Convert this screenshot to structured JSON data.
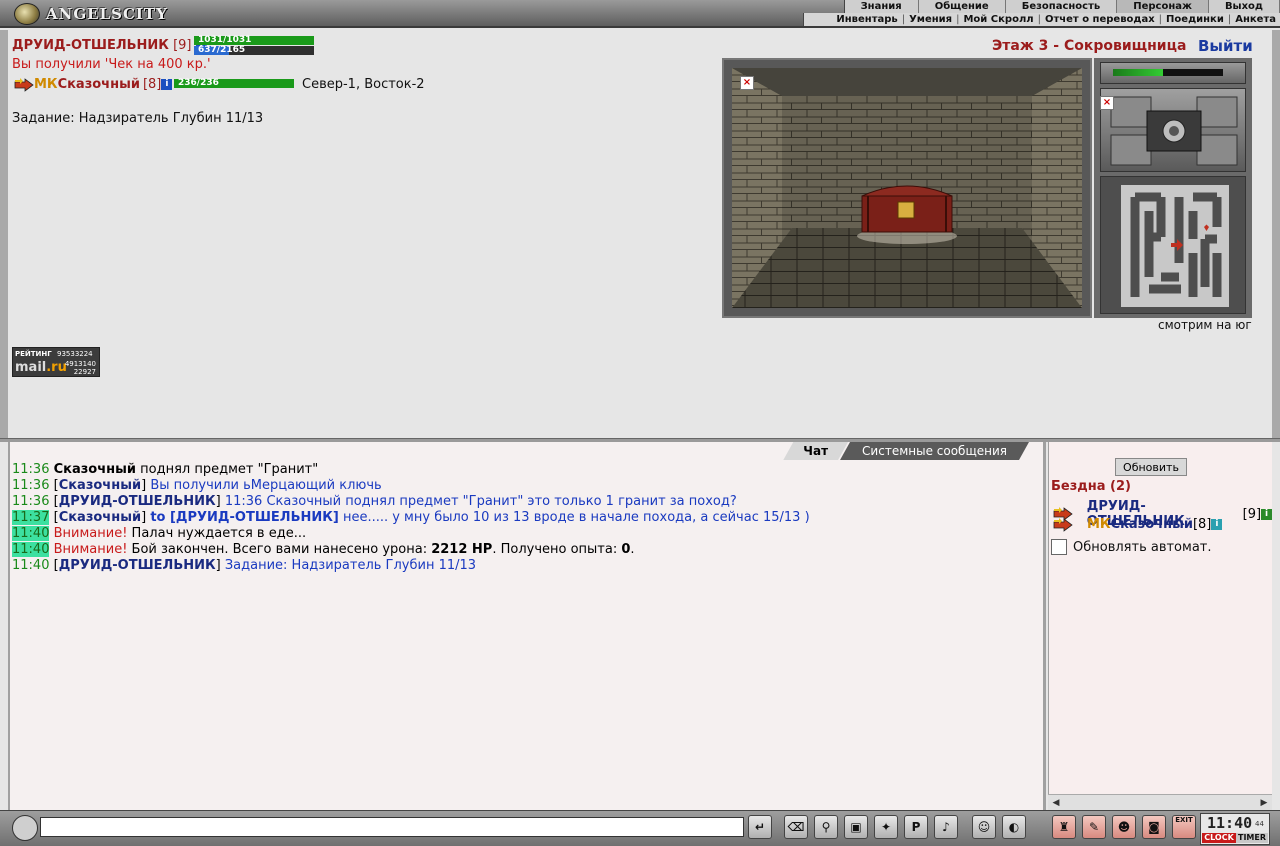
{
  "header": {
    "logo_text": "ANGELSCITY",
    "menu_top": [
      "Знания",
      "Общение",
      "Безопасность",
      "Персонаж",
      "Выход"
    ],
    "menu_sub": [
      "Инвентарь",
      "Умения",
      "Мой Скролл",
      "Отчет о переводах",
      "Поединки",
      "Анкета"
    ]
  },
  "player": {
    "name": "ДРУИД-ОТШЕЛЬНИК",
    "level": "[9]",
    "hp": "1031/1031",
    "hp_fraction": 1.0,
    "mana": "637/2165",
    "mana_fraction": 0.294,
    "received": "Вы получили 'Чек на 400 кр.'"
  },
  "companion": {
    "clan": "МК",
    "name": "Сказочный",
    "level": "[8]",
    "hp": "236/236",
    "hp_fraction": 1.0,
    "coords": "Север-1, Восток-2"
  },
  "task": "Задание: Надзиратель Глубин 11/13",
  "location": {
    "title": "Этаж 3 - Сокровищница",
    "exit_label": "Выйти",
    "facing": "смотрим на юг"
  },
  "rating": {
    "label": "РЕЙТИНГ",
    "value1": "93533224",
    "brand_prefix": "mail",
    "brand_suffix": ".ru",
    "value2": "4913140",
    "value3": "22927"
  },
  "chat": {
    "tabs": [
      "Чат",
      "Системные сообщения"
    ],
    "messages": [
      {
        "time": "11:36",
        "highlight": false,
        "parts": [
          {
            "text": "Сказочный",
            "style": "who-dark"
          },
          {
            "text": " поднял предмет \"Гранит\"",
            "style": "plain"
          }
        ]
      },
      {
        "time": "11:36",
        "highlight": false,
        "parts": [
          {
            "text": "[",
            "style": "plain"
          },
          {
            "text": "Сказочный",
            "style": "who"
          },
          {
            "text": "] ",
            "style": "plain"
          },
          {
            "text": "Вы получили ьМерцающий ключь",
            "style": "blue"
          }
        ]
      },
      {
        "time": "11:36",
        "highlight": false,
        "parts": [
          {
            "text": "[",
            "style": "plain"
          },
          {
            "text": "ДРУИД-ОТШЕЛЬНИК",
            "style": "who"
          },
          {
            "text": "] ",
            "style": "plain"
          },
          {
            "text": "11:36 Сказочный поднял предмет \"Гранит\" это только 1 гранит за поход?",
            "style": "blue"
          }
        ]
      },
      {
        "time": "11:37",
        "highlight": true,
        "parts": [
          {
            "text": "[",
            "style": "plain"
          },
          {
            "text": "Сказочный",
            "style": "who"
          },
          {
            "text": "] ",
            "style": "plain"
          },
          {
            "text": "to [ДРУИД-ОТШЕЛЬНИК]",
            "style": "who-blue"
          },
          {
            "text": " нее..... у мну было 10 из 13 вроде в начале похода, а сейчас 15/13 )",
            "style": "blue"
          }
        ]
      },
      {
        "time": "11:40",
        "highlight": true,
        "parts": [
          {
            "text": "Внимание!",
            "style": "red"
          },
          {
            "text": " Палач нуждается в еде...",
            "style": "plain"
          }
        ]
      },
      {
        "time": "11:40",
        "highlight": true,
        "parts": [
          {
            "text": "Внимание!",
            "style": "red"
          },
          {
            "text": " Бой закончен. Всего вами нанесено урона: ",
            "style": "plain"
          },
          {
            "text": "2212 HP",
            "style": "bold"
          },
          {
            "text": ". Получено опыта: ",
            "style": "plain"
          },
          {
            "text": "0",
            "style": "bold"
          },
          {
            "text": ".",
            "style": "plain"
          }
        ]
      },
      {
        "time": "11:40",
        "highlight": false,
        "parts": [
          {
            "text": "[",
            "style": "plain"
          },
          {
            "text": "ДРУИД-ОТШЕЛЬНИК",
            "style": "who"
          },
          {
            "text": "] ",
            "style": "plain"
          },
          {
            "text": "Задание: Надзиратель Глубин 11/13",
            "style": "blue"
          }
        ]
      }
    ]
  },
  "sidepanel": {
    "refresh_label": "Обновить",
    "location_name": "Бездна (2)",
    "players": [
      {
        "clan": "",
        "name": "ДРУИД-ОТШЕЛЬНИК",
        "level": "[9]"
      },
      {
        "clan": "МК",
        "name": "Сказочный",
        "level": "[8]"
      }
    ],
    "auto_label": "Обновлять автомат."
  },
  "bottom": {
    "chat_input_value": "",
    "clock_time": "11:40",
    "clock_sec": "44",
    "clock_label": "CLOCK",
    "timer_label": "TIMER",
    "exit_label": "EXIT"
  },
  "colors": {
    "accent_red": "#9b1c1c",
    "nick_blue": "#1a2a80",
    "hp_green": "#1a9a1a",
    "mana_blue": "#2a6ad0"
  }
}
